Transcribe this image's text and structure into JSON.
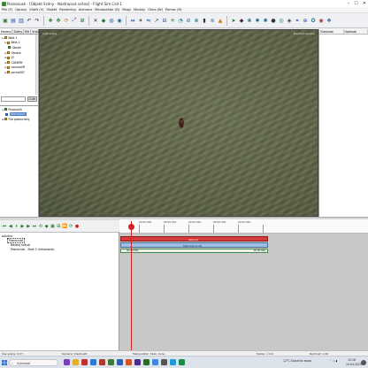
{
  "window": {
    "title": "Posnovusk - [Objekt Scény - Nástrojová scéna] - Flight Sim Cell-1"
  },
  "menu": [
    "Plik (F)",
    "Úpravy",
    "Vložit (V)",
    "Objekt",
    "Rendering",
    "Animace",
    "Manipulátor (D)",
    "Mapy",
    "Moduly",
    "Okna (W)",
    "Pomoc (H)"
  ],
  "left_panel": {
    "tabs": [
      "Modely",
      "Scény",
      "Efe",
      "Vrstv"
    ],
    "tree": [
      {
        "label": "Béla 1",
        "level": 0,
        "icon": "folder"
      },
      {
        "label": "Béla 2",
        "level": 1,
        "icon": "folder"
      },
      {
        "label": "Obsah",
        "level": 2,
        "icon": "model"
      },
      {
        "label": "Obrázk",
        "level": 1,
        "icon": "folder"
      },
      {
        "label": "Ví",
        "level": 1,
        "icon": "folder"
      },
      {
        "label": "CAMERY",
        "level": 1,
        "icon": "folder"
      },
      {
        "label": "cesnoaVR",
        "level": 1,
        "icon": "folder"
      },
      {
        "label": "porno007",
        "level": 1,
        "icon": "folder"
      }
    ],
    "search_button": "Zúžit",
    "tree2": [
      {
        "label": "Pracovník",
        "level": 0,
        "icon": "model"
      },
      {
        "label": "Nástrojová",
        "level": 1,
        "icon": "selected"
      },
      {
        "label": "File potenciony",
        "level": 0,
        "icon": "folder"
      }
    ]
  },
  "viewport": {
    "corner_label_left": "Celá scéna",
    "corner_label_right": "Přechod kamery"
  },
  "right_panel": {
    "columns": [
      "Vlastnost",
      "Hodnota"
    ]
  },
  "timeline": {
    "tree": [
      {
        "label": "Scéna",
        "level": 0
      },
      {
        "label": "Posnovusk",
        "level": 1
      },
      {
        "label": "Nástroj scénáj",
        "level": 2
      },
      {
        "label": "Posnovusk - Skok 2 (Intnovanie)",
        "level": 2
      }
    ],
    "ruler_ticks": [
      "00:00:000",
      "00:00:010",
      "00:00:020",
      "00:00:030",
      "00:00:040"
    ],
    "track_label_top": "Kamera",
    "track_label_mid": "Shot Cam 0  10",
    "track_start_label": "00:00:000",
    "track_end_label": "00:00:040"
  },
  "statusbar": {
    "left": "Čas scény: 0.0 f",
    "center_left": "Kamera: Vlastnosti",
    "center": "Manipulátor: Skok, Suns",
    "right_mid": "Kolize: ☐ 0.0",
    "right": "Rychlost: 1.00"
  },
  "taskbar": {
    "search_placeholder": "Vyhledat",
    "weather": "12°C  Slunečno skoro",
    "time": "10:16",
    "date": "10.04.2023"
  }
}
